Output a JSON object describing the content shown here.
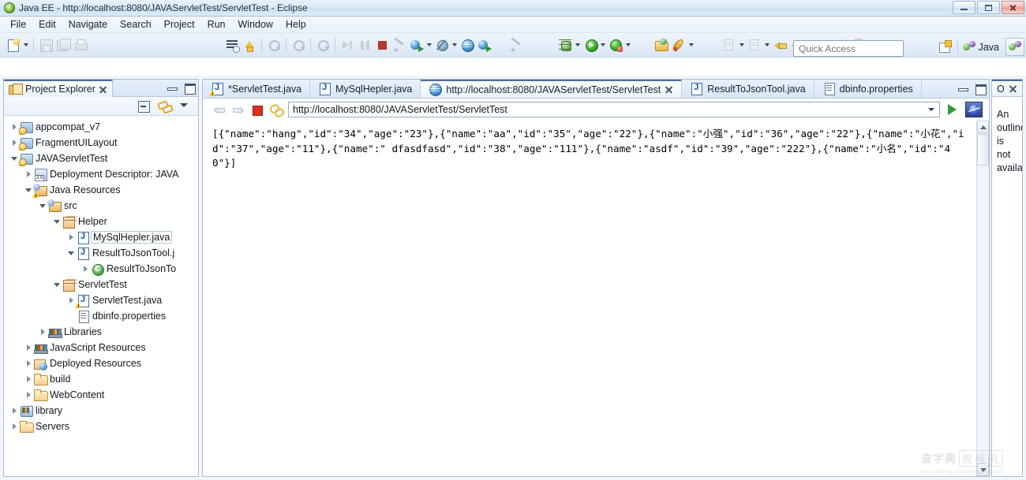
{
  "window": {
    "title": "Java EE - http://localhost:8080/JAVAServletTest/ServletTest - Eclipse",
    "app_icon": "eclipse-icon",
    "minimize_label": "",
    "maximize_label": "",
    "close_label": ""
  },
  "menu": {
    "items": [
      "File",
      "Edit",
      "Navigate",
      "Search",
      "Project",
      "Run",
      "Window",
      "Help"
    ]
  },
  "toolbar": {
    "groups": [
      {
        "buttons": [
          {
            "icon": "new-document-icon",
            "dropdown": true,
            "enabled": true
          },
          {
            "icon": "save-icon",
            "dropdown": false,
            "enabled": false
          },
          {
            "icon": "save-all-icon",
            "dropdown": false,
            "enabled": false
          },
          {
            "icon": "print-icon",
            "dropdown": false,
            "enabled": false
          }
        ]
      },
      {
        "buttons": [
          {
            "icon": "toggle-markoccurrences-icon",
            "dropdown": false,
            "enabled": true
          },
          {
            "icon": "build-all-icon",
            "dropdown": false,
            "enabled": true
          },
          {
            "icon": "search-icon",
            "dropdown": false,
            "enabled": false
          },
          {
            "icon": "last-edit-icon",
            "dropdown": false,
            "enabled": false
          },
          {
            "icon": "next-annotation-icon",
            "dropdown": false,
            "enabled": false
          },
          {
            "icon": "resume-icon",
            "dropdown": false,
            "enabled": false
          },
          {
            "icon": "suspend-icon",
            "dropdown": false,
            "enabled": false
          },
          {
            "icon": "terminate-icon",
            "dropdown": false,
            "enabled": false
          },
          {
            "icon": "disconnect-icon",
            "dropdown": false,
            "enabled": false
          },
          {
            "icon": "open-web-browser-icon",
            "dropdown": true,
            "enabled": true
          },
          {
            "icon": "new-server-icon",
            "dropdown": true,
            "enabled": true
          },
          {
            "icon": "globe-icon",
            "dropdown": false,
            "enabled": true
          },
          {
            "icon": "run-on-server-icon",
            "dropdown": false,
            "enabled": true
          }
        ]
      },
      {
        "buttons": [
          {
            "icon": "pencil-icon",
            "dropdown": false,
            "enabled": false
          },
          {
            "icon": "debug-icon",
            "dropdown": true,
            "enabled": true
          },
          {
            "icon": "run-icon",
            "dropdown": true,
            "enabled": true
          },
          {
            "icon": "run-external-tools-icon",
            "dropdown": true,
            "enabled": true
          },
          {
            "icon": "open-type-icon",
            "dropdown": false,
            "enabled": true
          },
          {
            "icon": "new-java-package-icon",
            "dropdown": true,
            "enabled": true
          },
          {
            "icon": "next-edit-icon",
            "dropdown": true,
            "enabled": false
          },
          {
            "icon": "previous-edit-icon",
            "dropdown": true,
            "enabled": false
          },
          {
            "icon": "back-icon",
            "dropdown": false,
            "enabled": true
          },
          {
            "icon": "back-history-icon",
            "dropdown": true,
            "enabled": true
          },
          {
            "icon": "forward-icon",
            "dropdown": true,
            "enabled": false
          },
          {
            "icon": "new-window-icon",
            "dropdown": false,
            "enabled": true
          }
        ]
      }
    ],
    "quick_access": {
      "placeholder": "Quick Access",
      "value": ""
    },
    "perspective": {
      "open_perspective_icon": "open-perspective-icon",
      "current_label": "Java",
      "current_icon": "java-perspective-icon",
      "active_icon": "javaee-perspective-icon"
    }
  },
  "project_explorer": {
    "tab_label": "Project Explorer",
    "tab_icon": "project-explorer-icon",
    "close_icon": "close-icon",
    "minimize_icon": "minimize-icon",
    "maximize_icon": "maximize-icon",
    "toolbar": [
      {
        "icon": "collapse-all-icon"
      },
      {
        "icon": "link-with-editor-icon"
      },
      {
        "icon": "view-menu-icon"
      }
    ],
    "tree": [
      {
        "label": "appcompat_v7",
        "indent": 0,
        "twisty": "collapsed",
        "icon": "java-project-icon",
        "warning": true,
        "selected": false
      },
      {
        "label": "FragmentUILayout",
        "indent": 0,
        "twisty": "collapsed",
        "icon": "java-project-icon",
        "warning": true,
        "selected": false
      },
      {
        "label": "JAVAServletTest",
        "indent": 0,
        "twisty": "expanded",
        "icon": "web-project-icon",
        "warning": true,
        "selected": false
      },
      {
        "label": "Deployment Descriptor: JAVA",
        "indent": 1,
        "twisty": "collapsed",
        "icon": "deployment-descriptor-icon",
        "warning": false,
        "selected": false
      },
      {
        "label": "Java Resources",
        "indent": 1,
        "twisty": "expanded",
        "icon": "java-resources-icon",
        "warning": true,
        "selected": false
      },
      {
        "label": "src",
        "indent": 2,
        "twisty": "expanded",
        "icon": "source-folder-icon",
        "warning": false,
        "selected": false
      },
      {
        "label": "Helper",
        "indent": 3,
        "twisty": "expanded",
        "icon": "package-icon",
        "warning": false,
        "selected": false
      },
      {
        "label": "MySqlHepler.java",
        "indent": 4,
        "twisty": "collapsed",
        "icon": "java-file-icon",
        "warning": false,
        "selected": true
      },
      {
        "label": "ResultToJsonTool.j",
        "indent": 4,
        "twisty": "expanded",
        "icon": "java-file-icon",
        "warning": false,
        "selected": false
      },
      {
        "label": "ResultToJsonTo",
        "indent": 5,
        "twisty": "collapsed",
        "icon": "java-class-icon",
        "warning": false,
        "selected": false
      },
      {
        "label": "ServletTest",
        "indent": 3,
        "twisty": "expanded",
        "icon": "package-icon",
        "warning": false,
        "selected": false
      },
      {
        "label": "ServletTest.java",
        "indent": 4,
        "twisty": "collapsed",
        "icon": "java-file-warning-icon",
        "warning": true,
        "selected": false
      },
      {
        "label": "dbinfo.properties",
        "indent": 4,
        "twisty": "none",
        "icon": "properties-file-icon",
        "warning": false,
        "selected": false
      },
      {
        "label": "Libraries",
        "indent": 2,
        "twisty": "collapsed",
        "icon": "libraries-icon",
        "warning": false,
        "selected": false
      },
      {
        "label": "JavaScript Resources",
        "indent": 1,
        "twisty": "collapsed",
        "icon": "libraries-icon",
        "warning": false,
        "selected": false
      },
      {
        "label": "Deployed Resources",
        "indent": 1,
        "twisty": "collapsed",
        "icon": "deployed-resources-icon",
        "warning": false,
        "selected": false
      },
      {
        "label": "build",
        "indent": 1,
        "twisty": "collapsed",
        "icon": "folder-icon",
        "warning": false,
        "selected": false
      },
      {
        "label": "WebContent",
        "indent": 1,
        "twisty": "collapsed",
        "icon": "folder-icon",
        "warning": false,
        "selected": false
      },
      {
        "label": "library",
        "indent": 0,
        "twisty": "collapsed",
        "icon": "library-project-icon",
        "warning": false,
        "selected": false
      },
      {
        "label": "Servers",
        "indent": 0,
        "twisty": "collapsed",
        "icon": "folder-icon",
        "warning": false,
        "selected": false
      }
    ]
  },
  "editor": {
    "tabs": [
      {
        "label": "*ServletTest.java",
        "icon": "java-file-warning-icon",
        "active": false,
        "closeable": false
      },
      {
        "label": "MySqlHepler.java",
        "icon": "java-file-icon",
        "active": false,
        "closeable": false
      },
      {
        "label": "http://localhost:8080/JAVAServletTest/ServletTest",
        "icon": "web-browser-icon",
        "active": true,
        "closeable": true
      },
      {
        "label": "ResultToJsonTool.java",
        "icon": "java-file-icon",
        "active": false,
        "closeable": false
      },
      {
        "label": "dbinfo.properties",
        "icon": "properties-file-icon",
        "active": false,
        "closeable": false
      }
    ],
    "minimize_icon": "minimize-icon",
    "maximize_icon": "maximize-icon",
    "browser": {
      "back_icon": "nav-back-icon",
      "forward_icon": "nav-forward-icon",
      "stop_icon": "stop-icon",
      "refresh_icon": "refresh-icon",
      "url": "http://localhost:8080/JAVAServletTest/ServletTest",
      "url_placeholder": "",
      "dropdown_icon": "chevron-down-icon",
      "go_icon": "go-icon",
      "open-external-icon": "open-external-browser-icon",
      "content": "[{\"name\":\"hang\",\"id\":\"34\",\"age\":\"23\"},{\"name\":\"aa\",\"id\":\"35\",\"age\":\"22\"},{\"name\":\"小强\",\"id\":\"36\",\"age\":\"22\"},{\"name\":\"小花\",\"id\":\"37\",\"age\":\"11\"},{\"name\":\" dfasdfasd\",\"id\":\"38\",\"age\":\"111\"},{\"name\":\"asdf\",\"id\":\"39\",\"age\":\"222\"},{\"name\":\"小名\",\"id\":\"40\"}]"
    }
  },
  "outline": {
    "tab_label": "O",
    "close_icon": "close-icon",
    "message": "An outline is not available."
  },
  "watermark": {
    "line1_a": "查字典",
    "line1_b": "教程网",
    "line2": "jiaocheng.chazidian.com"
  },
  "colors": {
    "accent": "#4b6e9b",
    "titlebar": "#dce9f7",
    "toolbar": "#e3ecf7",
    "selection_border": "#b8c6d6",
    "stop_red": "#dc2f20",
    "go_green": "#2e9b3a"
  }
}
